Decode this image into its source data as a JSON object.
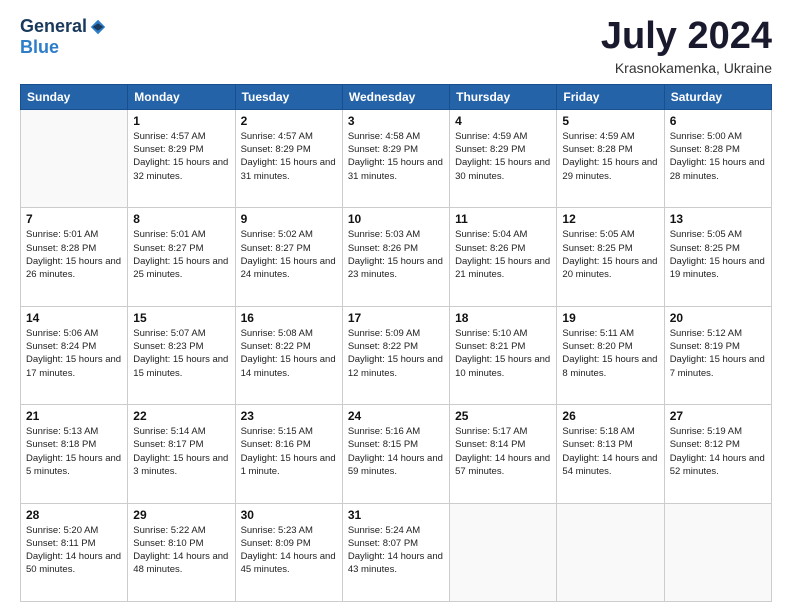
{
  "header": {
    "logo_general": "General",
    "logo_blue": "Blue",
    "month_title": "July 2024",
    "location": "Krasnokamenka, Ukraine"
  },
  "weekdays": [
    "Sunday",
    "Monday",
    "Tuesday",
    "Wednesday",
    "Thursday",
    "Friday",
    "Saturday"
  ],
  "weeks": [
    [
      {
        "day": "",
        "sunrise": "",
        "sunset": "",
        "daylight": ""
      },
      {
        "day": "1",
        "sunrise": "Sunrise: 4:57 AM",
        "sunset": "Sunset: 8:29 PM",
        "daylight": "Daylight: 15 hours and 32 minutes."
      },
      {
        "day": "2",
        "sunrise": "Sunrise: 4:57 AM",
        "sunset": "Sunset: 8:29 PM",
        "daylight": "Daylight: 15 hours and 31 minutes."
      },
      {
        "day": "3",
        "sunrise": "Sunrise: 4:58 AM",
        "sunset": "Sunset: 8:29 PM",
        "daylight": "Daylight: 15 hours and 31 minutes."
      },
      {
        "day": "4",
        "sunrise": "Sunrise: 4:59 AM",
        "sunset": "Sunset: 8:29 PM",
        "daylight": "Daylight: 15 hours and 30 minutes."
      },
      {
        "day": "5",
        "sunrise": "Sunrise: 4:59 AM",
        "sunset": "Sunset: 8:28 PM",
        "daylight": "Daylight: 15 hours and 29 minutes."
      },
      {
        "day": "6",
        "sunrise": "Sunrise: 5:00 AM",
        "sunset": "Sunset: 8:28 PM",
        "daylight": "Daylight: 15 hours and 28 minutes."
      }
    ],
    [
      {
        "day": "7",
        "sunrise": "Sunrise: 5:01 AM",
        "sunset": "Sunset: 8:28 PM",
        "daylight": "Daylight: 15 hours and 26 minutes."
      },
      {
        "day": "8",
        "sunrise": "Sunrise: 5:01 AM",
        "sunset": "Sunset: 8:27 PM",
        "daylight": "Daylight: 15 hours and 25 minutes."
      },
      {
        "day": "9",
        "sunrise": "Sunrise: 5:02 AM",
        "sunset": "Sunset: 8:27 PM",
        "daylight": "Daylight: 15 hours and 24 minutes."
      },
      {
        "day": "10",
        "sunrise": "Sunrise: 5:03 AM",
        "sunset": "Sunset: 8:26 PM",
        "daylight": "Daylight: 15 hours and 23 minutes."
      },
      {
        "day": "11",
        "sunrise": "Sunrise: 5:04 AM",
        "sunset": "Sunset: 8:26 PM",
        "daylight": "Daylight: 15 hours and 21 minutes."
      },
      {
        "day": "12",
        "sunrise": "Sunrise: 5:05 AM",
        "sunset": "Sunset: 8:25 PM",
        "daylight": "Daylight: 15 hours and 20 minutes."
      },
      {
        "day": "13",
        "sunrise": "Sunrise: 5:05 AM",
        "sunset": "Sunset: 8:25 PM",
        "daylight": "Daylight: 15 hours and 19 minutes."
      }
    ],
    [
      {
        "day": "14",
        "sunrise": "Sunrise: 5:06 AM",
        "sunset": "Sunset: 8:24 PM",
        "daylight": "Daylight: 15 hours and 17 minutes."
      },
      {
        "day": "15",
        "sunrise": "Sunrise: 5:07 AM",
        "sunset": "Sunset: 8:23 PM",
        "daylight": "Daylight: 15 hours and 15 minutes."
      },
      {
        "day": "16",
        "sunrise": "Sunrise: 5:08 AM",
        "sunset": "Sunset: 8:22 PM",
        "daylight": "Daylight: 15 hours and 14 minutes."
      },
      {
        "day": "17",
        "sunrise": "Sunrise: 5:09 AM",
        "sunset": "Sunset: 8:22 PM",
        "daylight": "Daylight: 15 hours and 12 minutes."
      },
      {
        "day": "18",
        "sunrise": "Sunrise: 5:10 AM",
        "sunset": "Sunset: 8:21 PM",
        "daylight": "Daylight: 15 hours and 10 minutes."
      },
      {
        "day": "19",
        "sunrise": "Sunrise: 5:11 AM",
        "sunset": "Sunset: 8:20 PM",
        "daylight": "Daylight: 15 hours and 8 minutes."
      },
      {
        "day": "20",
        "sunrise": "Sunrise: 5:12 AM",
        "sunset": "Sunset: 8:19 PM",
        "daylight": "Daylight: 15 hours and 7 minutes."
      }
    ],
    [
      {
        "day": "21",
        "sunrise": "Sunrise: 5:13 AM",
        "sunset": "Sunset: 8:18 PM",
        "daylight": "Daylight: 15 hours and 5 minutes."
      },
      {
        "day": "22",
        "sunrise": "Sunrise: 5:14 AM",
        "sunset": "Sunset: 8:17 PM",
        "daylight": "Daylight: 15 hours and 3 minutes."
      },
      {
        "day": "23",
        "sunrise": "Sunrise: 5:15 AM",
        "sunset": "Sunset: 8:16 PM",
        "daylight": "Daylight: 15 hours and 1 minute."
      },
      {
        "day": "24",
        "sunrise": "Sunrise: 5:16 AM",
        "sunset": "Sunset: 8:15 PM",
        "daylight": "Daylight: 14 hours and 59 minutes."
      },
      {
        "day": "25",
        "sunrise": "Sunrise: 5:17 AM",
        "sunset": "Sunset: 8:14 PM",
        "daylight": "Daylight: 14 hours and 57 minutes."
      },
      {
        "day": "26",
        "sunrise": "Sunrise: 5:18 AM",
        "sunset": "Sunset: 8:13 PM",
        "daylight": "Daylight: 14 hours and 54 minutes."
      },
      {
        "day": "27",
        "sunrise": "Sunrise: 5:19 AM",
        "sunset": "Sunset: 8:12 PM",
        "daylight": "Daylight: 14 hours and 52 minutes."
      }
    ],
    [
      {
        "day": "28",
        "sunrise": "Sunrise: 5:20 AM",
        "sunset": "Sunset: 8:11 PM",
        "daylight": "Daylight: 14 hours and 50 minutes."
      },
      {
        "day": "29",
        "sunrise": "Sunrise: 5:22 AM",
        "sunset": "Sunset: 8:10 PM",
        "daylight": "Daylight: 14 hours and 48 minutes."
      },
      {
        "day": "30",
        "sunrise": "Sunrise: 5:23 AM",
        "sunset": "Sunset: 8:09 PM",
        "daylight": "Daylight: 14 hours and 45 minutes."
      },
      {
        "day": "31",
        "sunrise": "Sunrise: 5:24 AM",
        "sunset": "Sunset: 8:07 PM",
        "daylight": "Daylight: 14 hours and 43 minutes."
      },
      {
        "day": "",
        "sunrise": "",
        "sunset": "",
        "daylight": ""
      },
      {
        "day": "",
        "sunrise": "",
        "sunset": "",
        "daylight": ""
      },
      {
        "day": "",
        "sunrise": "",
        "sunset": "",
        "daylight": ""
      }
    ]
  ]
}
